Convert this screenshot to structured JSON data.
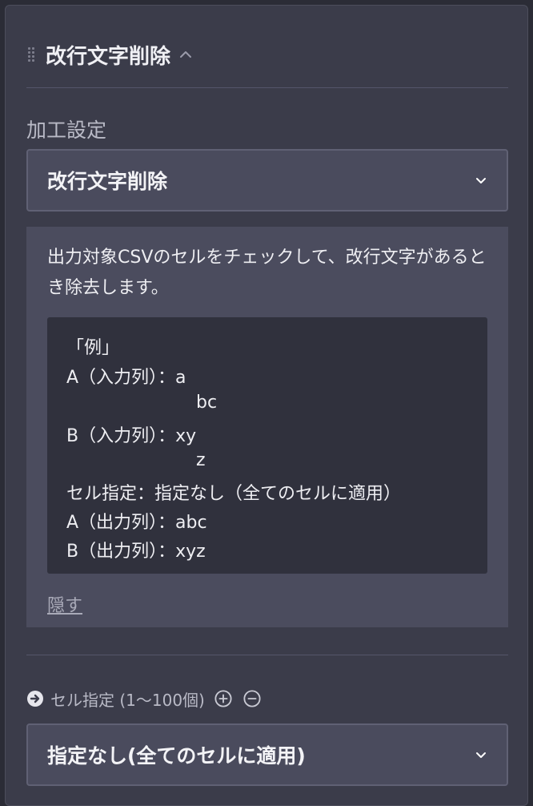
{
  "header": {
    "title": "改行文字削除"
  },
  "processing": {
    "label": "加工設定",
    "selected": "改行文字削除"
  },
  "info": {
    "description": "出力対象CSVのセルをチェックして、改行文字があるとき除去します。",
    "example_lines": [
      "「例」",
      "A（入力列）：a",
      "bc",
      "B（入力列）：xy",
      "z",
      "セル指定：指定なし（全てのセルに適用）",
      "A（出力列）：abc",
      "B（出力列）：xyz"
    ],
    "hide_label": "隠す"
  },
  "cell_spec": {
    "label": "セル指定 (1〜100個)",
    "selected": "指定なし(全てのセルに適用)"
  },
  "colors": {
    "background": "#2b2c36",
    "panel": "#3b3c4a",
    "select": "#4a4b5d",
    "info_box": "#4b4c5e",
    "code_block": "#30313d",
    "text": "#eeeef2",
    "muted": "#b9bac6"
  },
  "icons": {
    "drag": "drag-handle-icon",
    "collapse": "chevron-up-icon",
    "dropdown": "chevron-down-icon",
    "arrow": "arrow-right-circle-icon",
    "add": "plus-circle-icon",
    "remove": "minus-circle-icon"
  }
}
